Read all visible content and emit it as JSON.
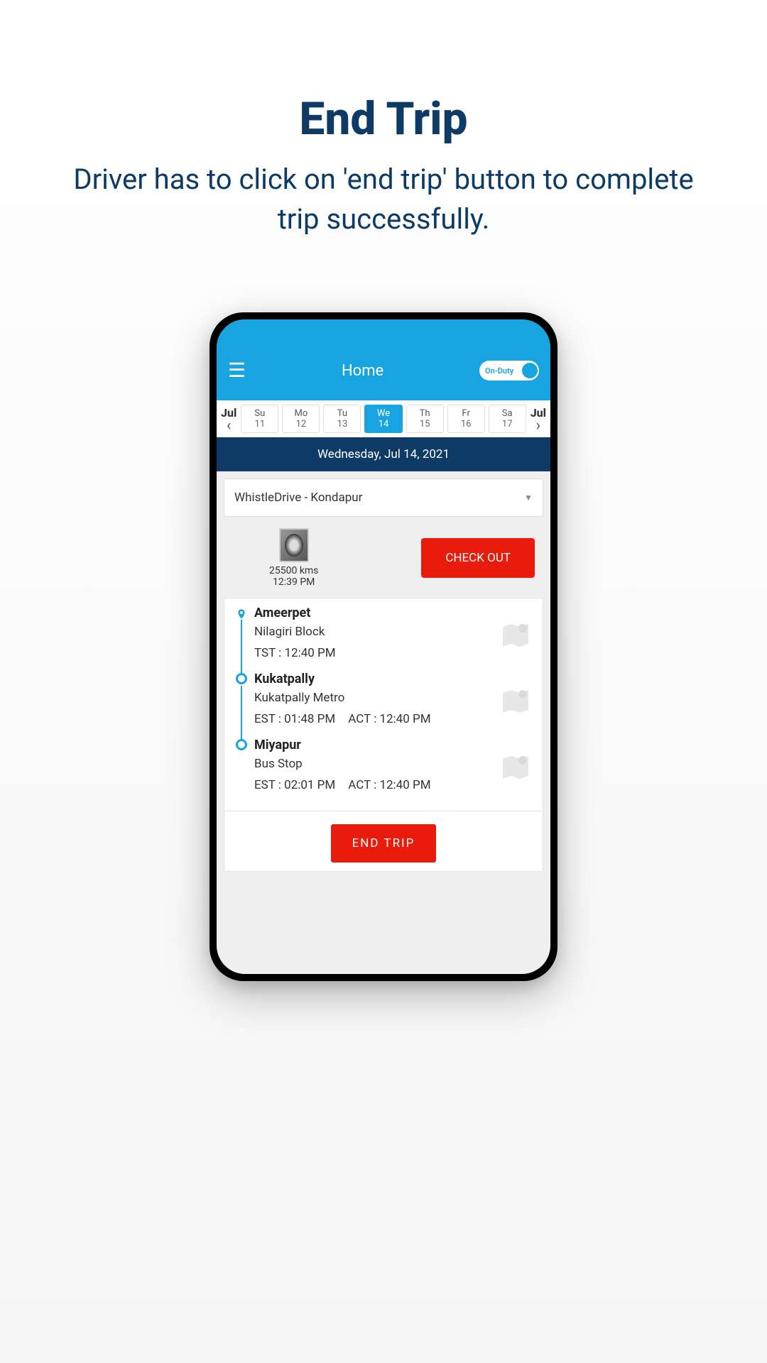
{
  "promo": {
    "title": "End Trip",
    "subtitle": "Driver has to click on 'end trip' button to complete trip successfully."
  },
  "header": {
    "title": "Home",
    "duty_label": "On-Duty"
  },
  "calendar": {
    "month_left": "Jul",
    "month_right": "Jul",
    "days": [
      {
        "name": "Su",
        "num": "11",
        "active": false
      },
      {
        "name": "Mo",
        "num": "12",
        "active": false
      },
      {
        "name": "Tu",
        "num": "13",
        "active": false
      },
      {
        "name": "We",
        "num": "14",
        "active": true
      },
      {
        "name": "Th",
        "num": "15",
        "active": false
      },
      {
        "name": "Fr",
        "num": "16",
        "active": false
      },
      {
        "name": "Sa",
        "num": "17",
        "active": false
      }
    ],
    "date_display": "Wednesday,  Jul 14, 2021"
  },
  "route_select": {
    "value": "WhistleDrive - Kondapur"
  },
  "odometer": {
    "kms": "25500 kms",
    "time": "12:39 PM"
  },
  "buttons": {
    "checkout": "CHECK OUT",
    "endtrip": "END TRIP"
  },
  "stops": [
    {
      "name": "Ameerpet",
      "sub": "Nilagiri Block",
      "est_label": "TST : 12:40 PM",
      "act_label": "",
      "marker": "pin"
    },
    {
      "name": "Kukatpally",
      "sub": "Kukatpally Metro",
      "est_label": "EST : 01:48 PM",
      "act_label": "ACT : 12:40 PM",
      "marker": "circle"
    },
    {
      "name": "Miyapur",
      "sub": "Bus Stop",
      "est_label": "EST : 02:01 PM",
      "act_label": "ACT : 12:40 PM",
      "marker": "circle"
    }
  ]
}
